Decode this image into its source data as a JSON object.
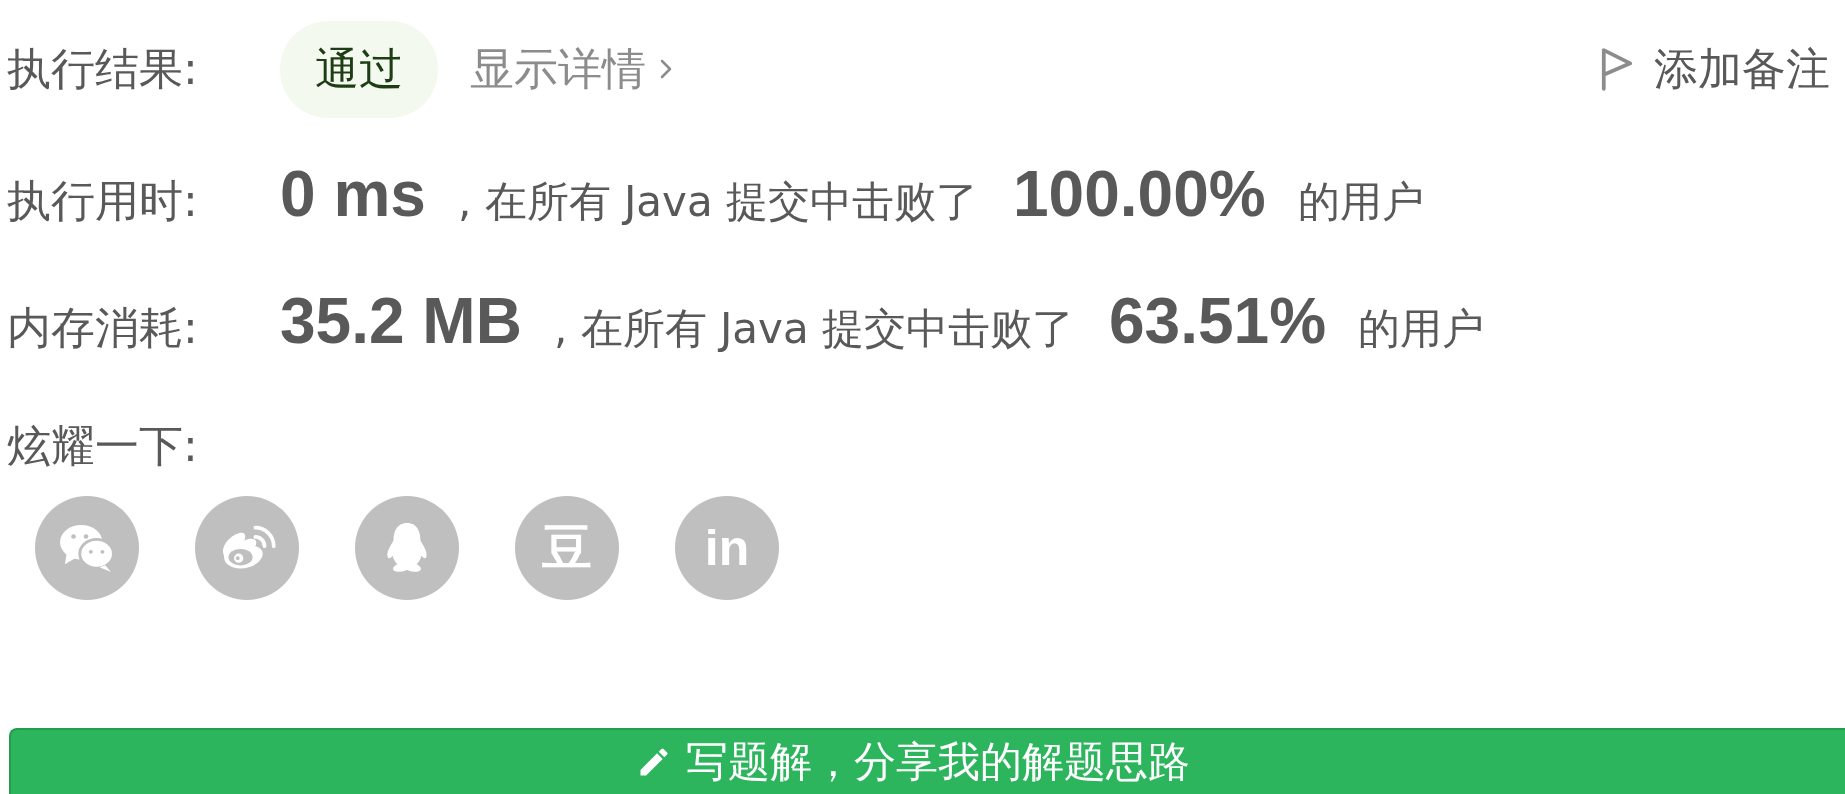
{
  "result": {
    "label": "执行结果:",
    "status": "通过",
    "passed": true,
    "details_link": "显示详情",
    "add_note": "添加备注"
  },
  "stats": [
    {
      "label": "执行用时:",
      "value": "0 ms",
      "comparison": ", 在所有 Java 提交中击败了",
      "percent": "100.00%",
      "suffix": "的用户"
    },
    {
      "label": "内存消耗:",
      "value": "35.2 MB",
      "comparison": ", 在所有 Java 提交中击败了",
      "percent": "63.51%",
      "suffix": "的用户"
    }
  ],
  "share": {
    "label": "炫耀一下:",
    "buttons": [
      {
        "kind": "bubbles"
      },
      {
        "kind": "swirl"
      },
      {
        "kind": "penguin"
      },
      {
        "kind": "glyph",
        "text": "豆"
      },
      {
        "kind": "glyph",
        "text": "in"
      }
    ]
  },
  "write_solution_button": "写题解，分享我的解题思路"
}
